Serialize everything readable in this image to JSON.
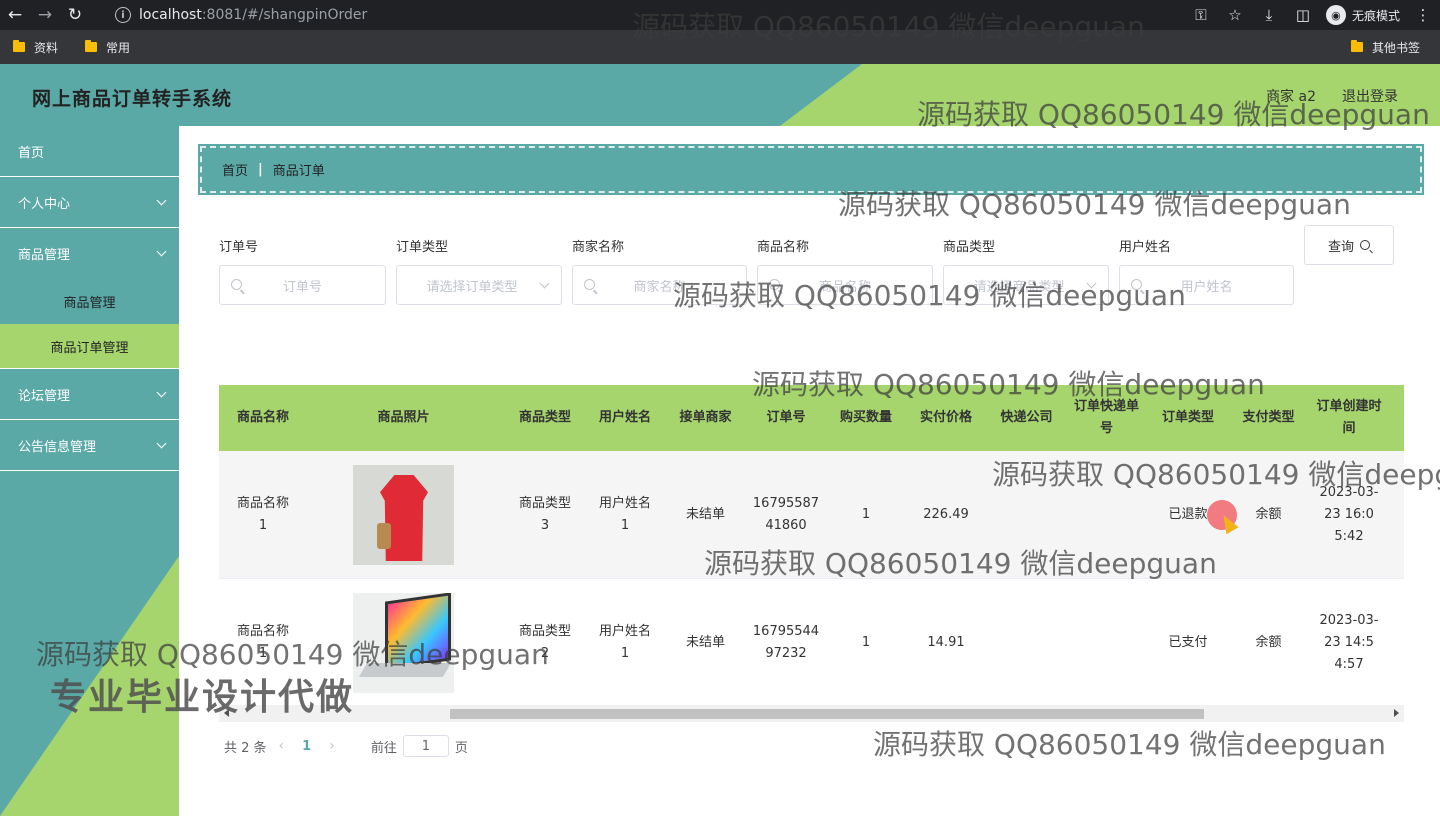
{
  "browser": {
    "url_host": "localhost",
    "url_rest": ":8081/#/shangpinOrder",
    "incognito_label": "无痕模式",
    "bookmarks": [
      "资料",
      "常用"
    ],
    "other_bookmarks": "其他书签"
  },
  "header": {
    "title": "网上商品订单转手系统",
    "user": "商家 a2",
    "logout": "退出登录"
  },
  "sidebar": {
    "items": [
      {
        "label": "首页"
      },
      {
        "label": "个人中心"
      },
      {
        "label": "商品管理"
      },
      {
        "label": "论坛管理"
      },
      {
        "label": "公告信息管理"
      }
    ],
    "sub_items": [
      {
        "label": "商品管理"
      },
      {
        "label": "商品订单管理"
      }
    ]
  },
  "breadcrumb": {
    "home": "首页",
    "sep": "|",
    "current": "商品订单"
  },
  "filters": [
    {
      "label": "订单号",
      "placeholder": "订单号"
    },
    {
      "label": "订单类型",
      "placeholder": "请选择订单类型"
    },
    {
      "label": "商家名称",
      "placeholder": "商家名称"
    },
    {
      "label": "商品名称",
      "placeholder": "商品名称"
    },
    {
      "label": "商品类型",
      "placeholder": "请选择商品类型"
    },
    {
      "label": "用户姓名",
      "placeholder": "用户姓名"
    }
  ],
  "query_button": "查询",
  "table": {
    "headers": [
      "商品名称",
      "商品照片",
      "商品类型",
      "用户姓名",
      "接单商家",
      "订单号",
      "购买数量",
      "实付价格",
      "快递公司",
      "订单快递单号",
      "订单类型",
      "支付类型",
      "订单创建时间"
    ],
    "rows": [
      {
        "name": "商品名称1",
        "type": "商品类型3",
        "user": "用户姓名1",
        "merchant": "未结单",
        "order_no": "1679558741860",
        "qty": "1",
        "price": "226.49",
        "express": "",
        "express_no": "",
        "order_type": "已退款",
        "pay_type": "余额",
        "created": "2023-03-23 16:05:42"
      },
      {
        "name": "商品名称1",
        "type": "商品类型2",
        "user": "用户姓名1",
        "merchant": "未结单",
        "order_no": "1679554497232",
        "qty": "1",
        "price": "14.91",
        "express": "",
        "express_no": "",
        "order_type": "已支付",
        "pay_type": "余额",
        "created": "2023-03-23 14:54:57"
      }
    ]
  },
  "pagination": {
    "total": "共 2 条",
    "current": "1",
    "goto_label": "前往",
    "goto_value": "1",
    "page_suffix": "页"
  },
  "watermarks": {
    "text": "源码获取 QQ86050149 微信deepguan",
    "promo": "专业毕业设计代做"
  },
  "colors": {
    "teal": "#5ba9a7",
    "green": "#a6d56e"
  }
}
